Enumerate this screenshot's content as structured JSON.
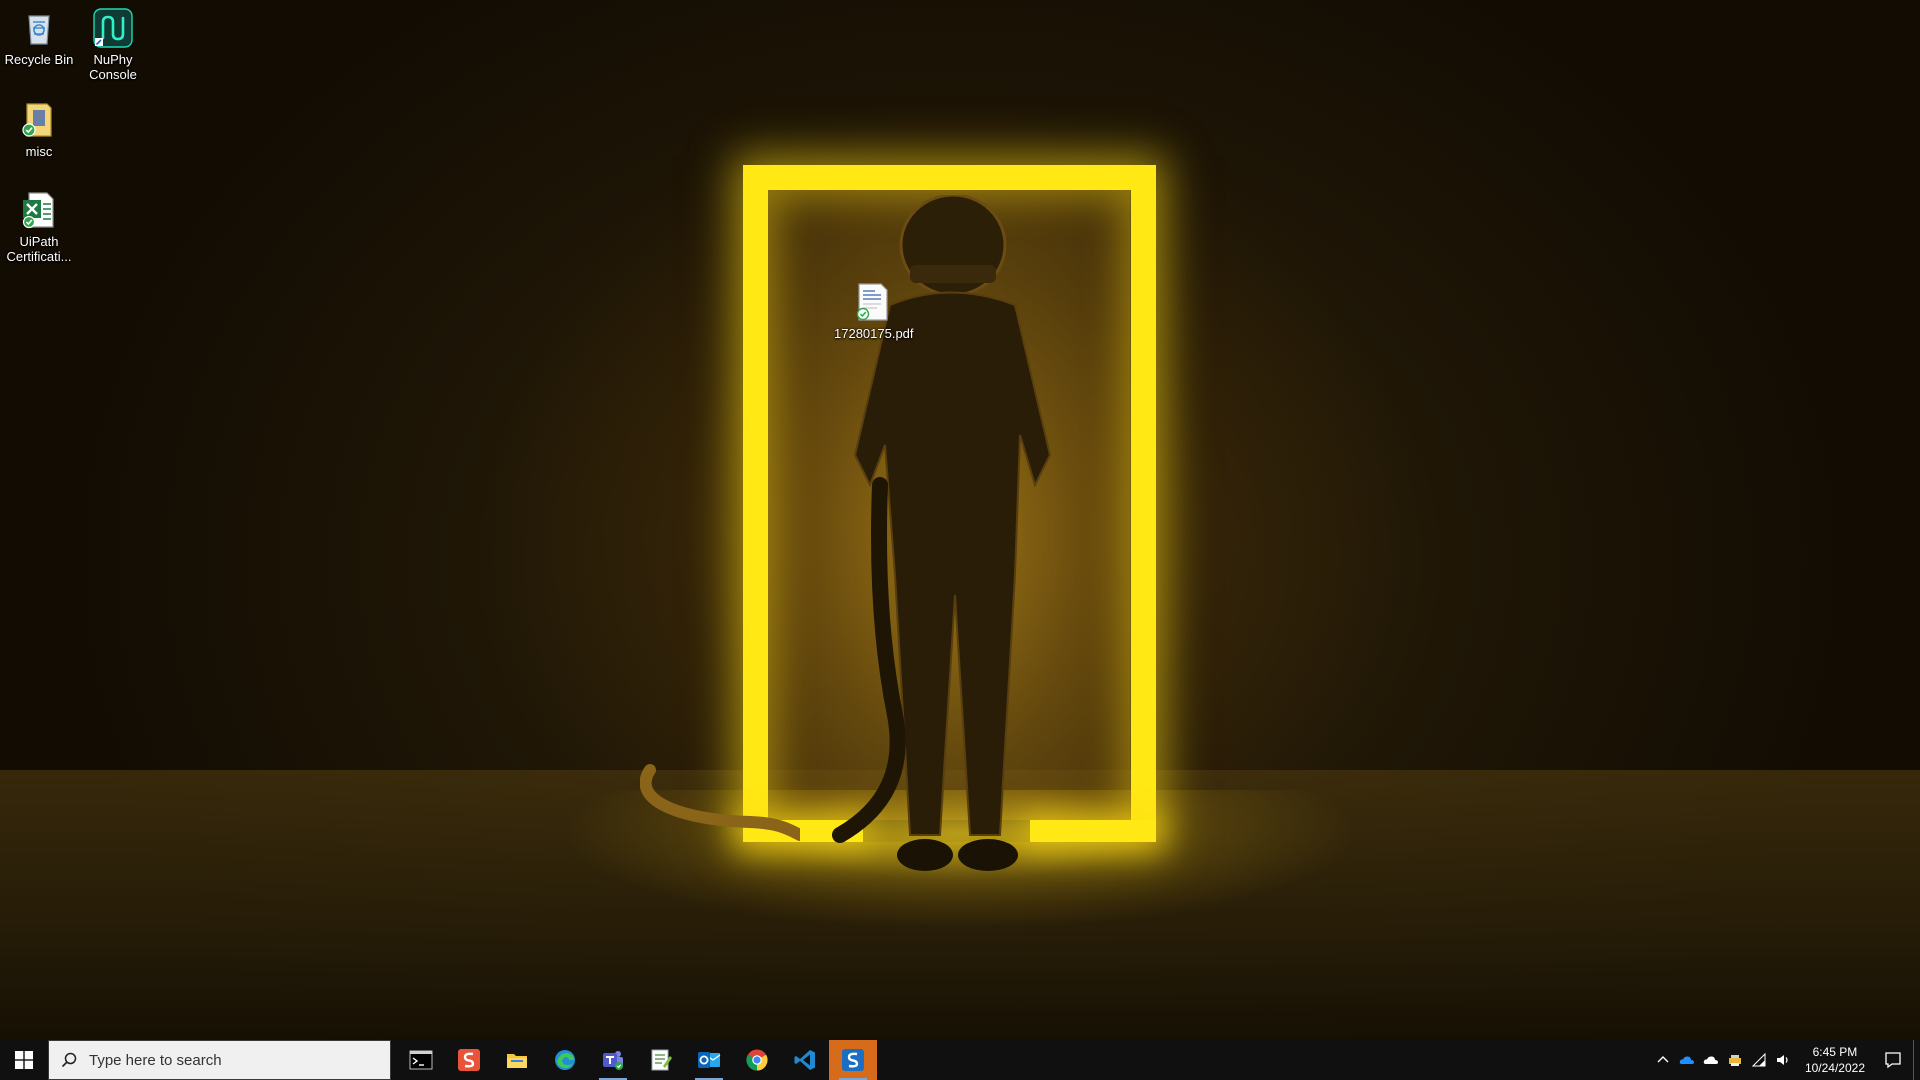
{
  "desktop": {
    "icons": [
      {
        "name": "recycle-bin",
        "label": "Recycle Bin"
      },
      {
        "name": "nuphy-console",
        "label": "NuPhy Console"
      },
      {
        "name": "misc",
        "label": "misc"
      },
      {
        "name": "uipath-certification",
        "label": "UiPath Certificati..."
      },
      {
        "name": "pdf-file",
        "label": "17280175.pdf"
      }
    ]
  },
  "taskbar": {
    "search_placeholder": "Type here to search",
    "apps": [
      {
        "icon": "terminal-icon",
        "title": "Terminal"
      },
      {
        "icon": "slides-icon",
        "title": "Presentation"
      },
      {
        "icon": "file-explorer-icon",
        "title": "File Explorer"
      },
      {
        "icon": "edge-icon",
        "title": "Microsoft Edge"
      },
      {
        "icon": "teams-icon",
        "title": "Microsoft Teams"
      },
      {
        "icon": "notepad-icon",
        "title": "Notepad"
      },
      {
        "icon": "outlook-icon",
        "title": "Outlook"
      },
      {
        "icon": "chrome-icon",
        "title": "Google Chrome"
      },
      {
        "icon": "vscode-icon",
        "title": "Visual Studio Code"
      },
      {
        "icon": "snagit-icon",
        "title": "Snagit"
      }
    ],
    "clock": {
      "time": "6:45 PM",
      "date": "10/24/2022"
    },
    "colors": {
      "background": "#101010",
      "active": "#d66b1c",
      "neon": "#ffe814"
    }
  }
}
